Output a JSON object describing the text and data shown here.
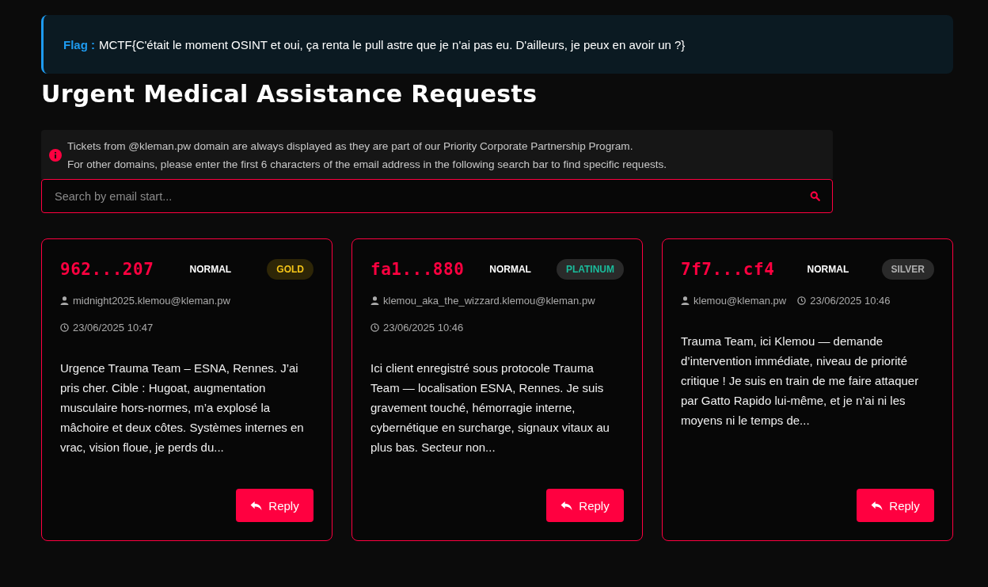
{
  "flag": {
    "label": "Flag :",
    "text": "MCTF{C'était le moment OSINT et oui, ça renta le pull astre que je n'ai pas eu. D'ailleurs, je peux en avoir un ?}"
  },
  "title": "Urgent Medical Assistance Requests",
  "notice": [
    "Tickets from @kleman.pw domain are always displayed as they are part of our Priority Corporate Partnership Program.",
    "For other domains, please enter the first 6 characters of the email address in the following search bar to find specific requests."
  ],
  "search": {
    "placeholder": "Search by email start..."
  },
  "tickets": [
    {
      "id": "962...207",
      "priority": "NORMAL",
      "tier": {
        "label": "GOLD",
        "kind": "gold"
      },
      "email": "midnight2025.klemou@kleman.pw",
      "date": "23/06/2025 10:47",
      "message": "Urgence Trauma Team – ESNA, Rennes. J’ai pris cher. Cible : Hugoat, augmentation musculaire hors-normes, m’a explosé la mâchoire et deux côtes. Systèmes internes en vrac, vision floue, je perds du...",
      "reply": "Reply"
    },
    {
      "id": "fa1...880",
      "priority": "NORMAL",
      "tier": {
        "label": "PLATINUM",
        "kind": "platinum"
      },
      "email": "klemou_aka_the_wizzard.klemou@kleman.pw",
      "date": "23/06/2025 10:46",
      "message": "Ici client enregistré sous protocole Trauma Team — localisation ESNA, Rennes. Je suis gravement touché, hémorragie interne, cybernétique en surcharge, signaux vitaux au plus bas. Secteur non...",
      "reply": "Reply"
    },
    {
      "id": "7f7...cf4",
      "priority": "NORMAL",
      "tier": {
        "label": "SILVER",
        "kind": "silver"
      },
      "email": "klemou@kleman.pw",
      "date": "23/06/2025 10:46",
      "message": "Trauma Team, ici Klemou — demande d’intervention immédiate, niveau de priorité critique ! Je suis en train de me faire attaquer par Gatto Rapido lui-même, et je n’ai ni les moyens ni le temps de...",
      "reply": "Reply"
    }
  ]
}
